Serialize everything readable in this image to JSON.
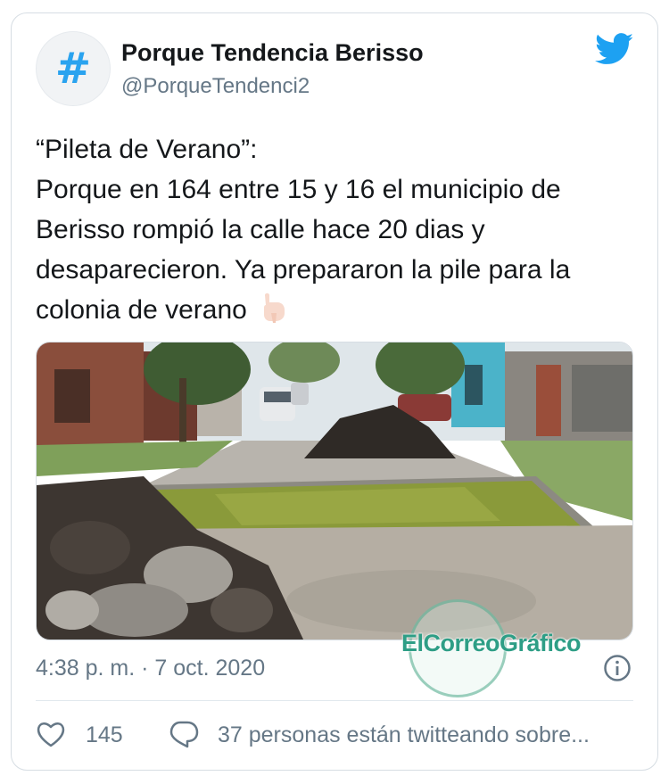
{
  "tweet": {
    "display_name": "Porque Tendencia Berisso",
    "handle": "@PorqueTendenci2",
    "avatar_symbol": "#",
    "text_lines": [
      "“Pileta de Verano”:",
      "Porque en 164 entre 15 y 16 el municipio de",
      "Berisso rompió la calle hace 20 dias y",
      "desaparecieron. Ya prepararon la pile para la",
      "colonia de verano"
    ],
    "trailing_emoji": "pointing-down-hand",
    "timestamp": "4:38 p. m. · 7 oct. 2020",
    "like_count": "145",
    "people_text": "37 personas están twitteando sobre..."
  },
  "watermark": {
    "text": "ElCorreoGráfico"
  },
  "icons": {
    "logo": "twitter-bird-icon",
    "info": "info-icon",
    "like": "heart-icon",
    "reply": "speech-bubble-icon"
  },
  "colors": {
    "twitter_blue": "#1da1f2",
    "text_primary": "#14171a",
    "text_secondary": "#657786",
    "border": "#d6dde3"
  }
}
